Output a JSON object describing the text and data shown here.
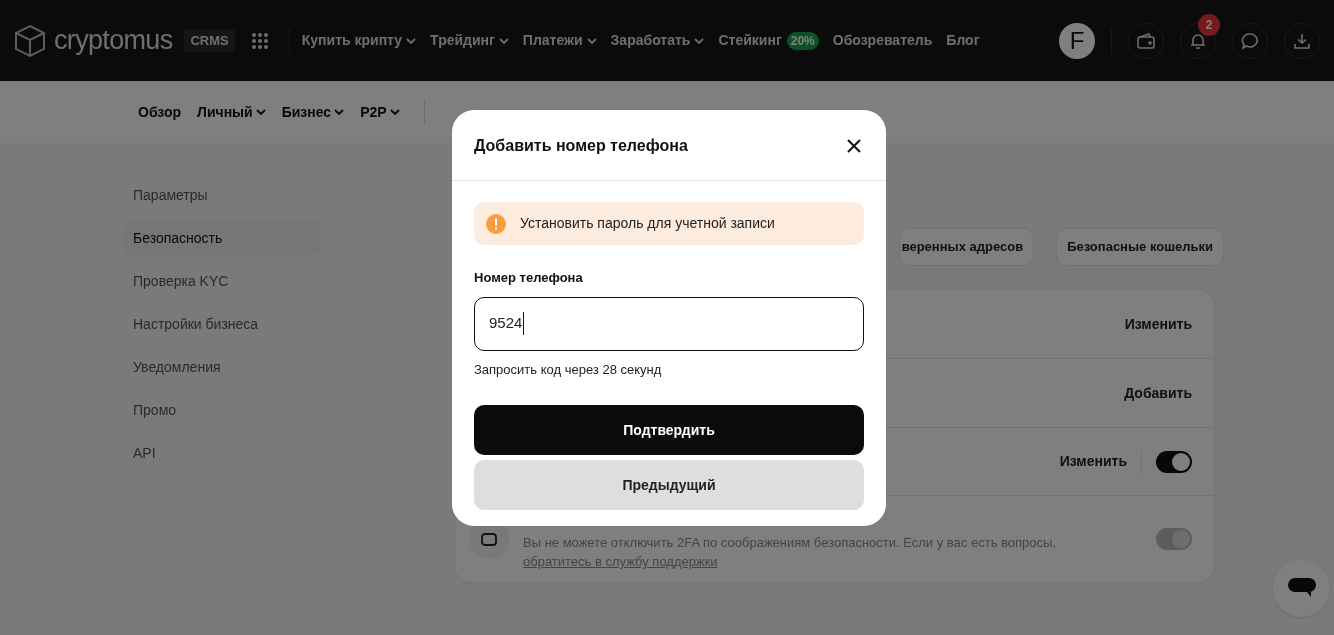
{
  "header": {
    "logo_text": "cryptomus",
    "logo_badge": "CRMS",
    "nav": [
      {
        "label": "Купить крипту",
        "dropdown": true
      },
      {
        "label": "Трейдинг",
        "dropdown": true
      },
      {
        "label": "Платежи",
        "dropdown": true
      },
      {
        "label": "Заработать",
        "dropdown": true
      },
      {
        "label": "Стейкинг",
        "dropdown": false,
        "badge": "20%"
      },
      {
        "label": "Обозреватель",
        "dropdown": false
      },
      {
        "label": "Блог",
        "dropdown": false
      }
    ],
    "avatar_letter": "F",
    "notification_count": "2"
  },
  "subnav": [
    {
      "label": "Обзор",
      "dropdown": false
    },
    {
      "label": "Личный",
      "dropdown": true
    },
    {
      "label": "Бизнес",
      "dropdown": true
    },
    {
      "label": "P2P",
      "dropdown": true
    }
  ],
  "sidebar": {
    "items": [
      {
        "label": "Параметры",
        "selected": false
      },
      {
        "label": "Безопасность",
        "selected": true
      },
      {
        "label": "Проверка KYC",
        "selected": false
      },
      {
        "label": "Настройки бизнеса",
        "selected": false
      },
      {
        "label": "Уведомления",
        "selected": false
      },
      {
        "label": "Промо",
        "selected": false
      },
      {
        "label": "API",
        "selected": false
      }
    ]
  },
  "tabs": [
    {
      "label": "веренных адресов",
      "selected": false
    },
    {
      "label": "Безопасные кошельки",
      "selected": false
    }
  ],
  "security_rows": [
    {
      "kind": "action",
      "action": "Изменить"
    },
    {
      "kind": "action",
      "action": "Добавить"
    },
    {
      "kind": "toggle",
      "action": "Изменить",
      "on": true,
      "disabled": false
    },
    {
      "kind": "notice",
      "description": "Вы не можете отключить 2FA по соображениям безопасности. Если у вас есть вопросы,",
      "link": "обратитесь в службу поддержки",
      "on": true,
      "disabled": true
    }
  ],
  "modal": {
    "title": "Добавить номер телефона",
    "alert": "Установить пароль для учетной записи",
    "field_label": "Номер телефона",
    "value": "9524",
    "hint": "Запросить код через 28 секунд",
    "primary_button": "Подтвердить",
    "secondary_button": "Предыдущий"
  }
}
